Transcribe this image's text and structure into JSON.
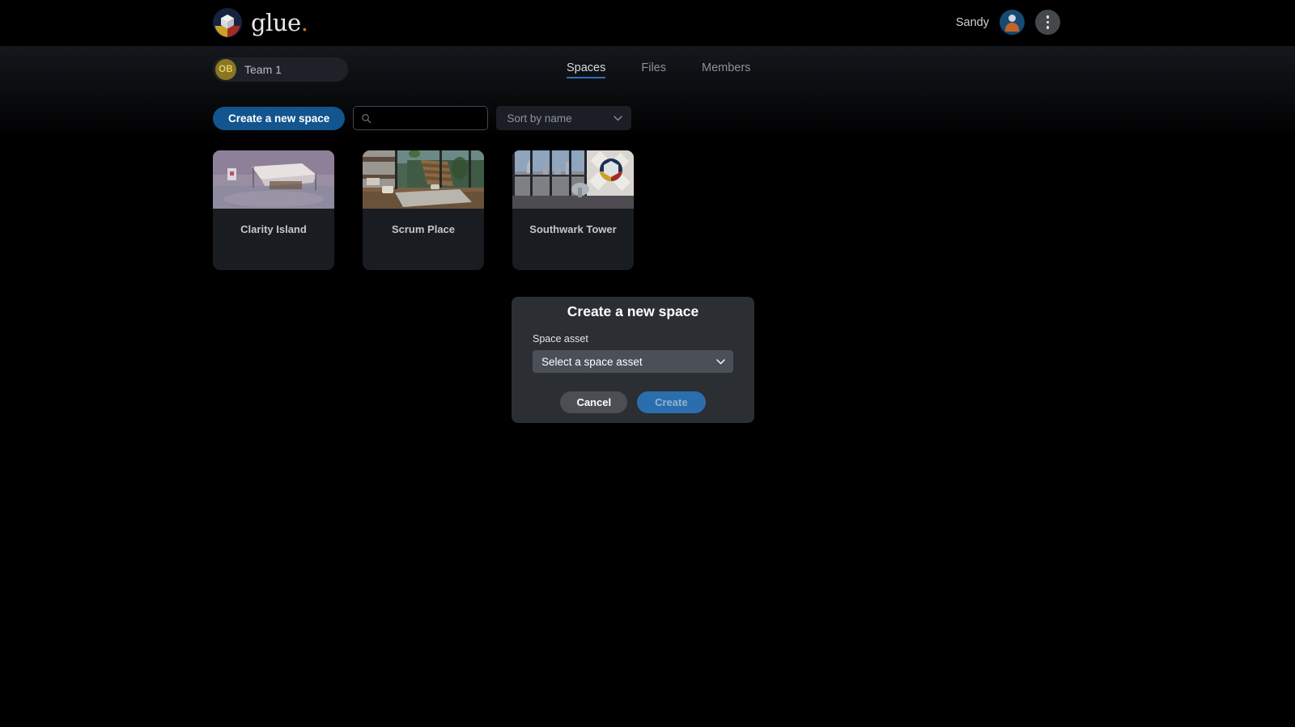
{
  "header": {
    "brand_name": "glue",
    "brand_dot": ".",
    "logo_icon": "glue-cube-logo-icon",
    "user_name": "Sandy",
    "avatar_icon": "user-avatar-icon",
    "menu_icon": "kebab-menu-icon"
  },
  "nav": {
    "team": {
      "badge": "OB",
      "name": "Team 1"
    },
    "tabs": [
      {
        "label": "Spaces",
        "active": true
      },
      {
        "label": "Files",
        "active": false
      },
      {
        "label": "Members",
        "active": false
      }
    ]
  },
  "toolbar": {
    "create_space_label": "Create a new space",
    "search": {
      "value": "",
      "placeholder": "",
      "icon": "search-icon"
    },
    "sort": {
      "selected": "Sort by name",
      "icon": "chevron-down-icon"
    }
  },
  "spaces": [
    {
      "title": "Clarity Island",
      "thumb": "clarity"
    },
    {
      "title": "Scrum Place",
      "thumb": "scrum"
    },
    {
      "title": "Southwark Tower",
      "thumb": "south"
    }
  ],
  "modal": {
    "title": "Create a new space",
    "field_label": "Space asset",
    "select": {
      "selected": "Select a space asset",
      "icon": "chevron-down-icon"
    },
    "cancel_label": "Cancel",
    "create_label": "Create"
  },
  "colors": {
    "page_bg": "#000000",
    "accent_blue": "#12558f",
    "tab_underline": "#2f6fba",
    "modal_bg": "#2b2e33",
    "team_badge": "#8a7520",
    "brand_dot": "#c97a1c"
  }
}
